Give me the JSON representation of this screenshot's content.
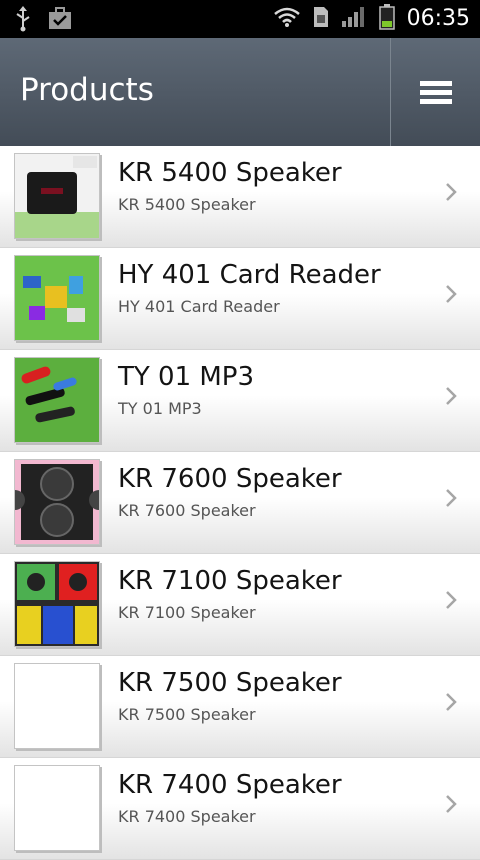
{
  "status_bar": {
    "time": "06:35",
    "icons": [
      "usb-icon",
      "briefcase-icon",
      "wifi-icon",
      "sim-card-icon",
      "signal-icon",
      "battery-icon"
    ]
  },
  "action_bar": {
    "title": "Products",
    "menu_icon": "menu-icon"
  },
  "colors": {
    "action_bar": "#4d5661",
    "battery": "#7ec82a",
    "chevron": "#a6a6a6"
  },
  "products": [
    {
      "name": "KR 5400 Speaker",
      "subtitle": "KR 5400 Speaker"
    },
    {
      "name": "HY 401 Card Reader",
      "subtitle": "HY 401 Card Reader"
    },
    {
      "name": "TY 01 MP3",
      "subtitle": "TY 01 MP3"
    },
    {
      "name": "KR 7600 Speaker",
      "subtitle": "KR 7600 Speaker"
    },
    {
      "name": "KR 7100 Speaker",
      "subtitle": "KR 7100 Speaker"
    },
    {
      "name": "KR 7500 Speaker",
      "subtitle": "KR 7500 Speaker"
    },
    {
      "name": "KR 7400 Speaker",
      "subtitle": "KR 7400 Speaker"
    }
  ]
}
